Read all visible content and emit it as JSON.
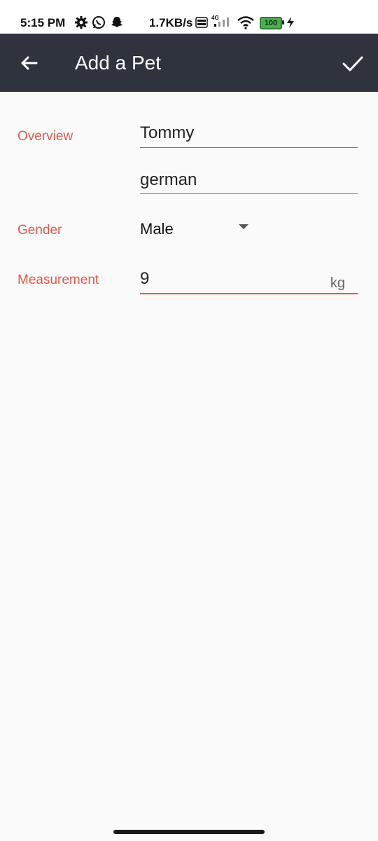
{
  "status_bar": {
    "time": "5:15 PM",
    "speed": "1.7KB/s",
    "network": "4G",
    "volte": "VoLTE",
    "battery": "100"
  },
  "toolbar": {
    "title": "Add a Pet"
  },
  "form": {
    "overview_label": "Overview",
    "name_value": "Tommy",
    "breed_value": "german",
    "gender_label": "Gender",
    "gender_value": "Male",
    "measurement_label": "Measurement",
    "measurement_value": "9",
    "measurement_unit": "kg"
  },
  "colors": {
    "accent": "#e2574c",
    "toolbar": "#2e333d",
    "background": "#fafafa"
  }
}
